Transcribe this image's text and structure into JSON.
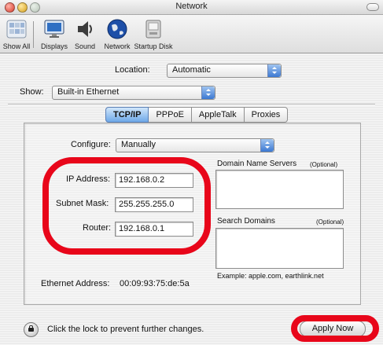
{
  "window": {
    "title": "Network"
  },
  "toolbar": {
    "items": [
      {
        "label": "Show All",
        "icon": "apple-logo-icon"
      },
      {
        "label": "Displays",
        "icon": "display-icon"
      },
      {
        "label": "Sound",
        "icon": "speaker-icon"
      },
      {
        "label": "Network",
        "icon": "globe-icon"
      },
      {
        "label": "Startup Disk",
        "icon": "disk-icon"
      }
    ]
  },
  "location": {
    "label": "Location:",
    "value": "Automatic"
  },
  "show": {
    "label": "Show:",
    "value": "Built-in Ethernet"
  },
  "tabs": [
    {
      "label": "TCP/IP",
      "active": true
    },
    {
      "label": "PPPoE",
      "active": false
    },
    {
      "label": "AppleTalk",
      "active": false
    },
    {
      "label": "Proxies",
      "active": false
    }
  ],
  "tcpip": {
    "configure": {
      "label": "Configure:",
      "value": "Manually"
    },
    "ip_address": {
      "label": "IP Address:",
      "value": "192.168.0.2"
    },
    "subnet_mask": {
      "label": "Subnet Mask:",
      "value": "255.255.255.0"
    },
    "router": {
      "label": "Router:",
      "value": "192.168.0.1"
    },
    "dns": {
      "label": "Domain Name Servers",
      "optional": "(Optional)",
      "value": ""
    },
    "search_domains": {
      "label": "Search Domains",
      "optional": "(Optional)",
      "value": ""
    },
    "example": "Example: apple.com, earthlink.net",
    "ethernet": {
      "label": "Ethernet Address:",
      "value": "00:09:93:75:de:5a"
    }
  },
  "footer": {
    "lock_text": "Click the lock to prevent further changes.",
    "apply_label": "Apply Now"
  },
  "colors": {
    "highlight": "#e8061a",
    "accent": "#3b78d2"
  }
}
